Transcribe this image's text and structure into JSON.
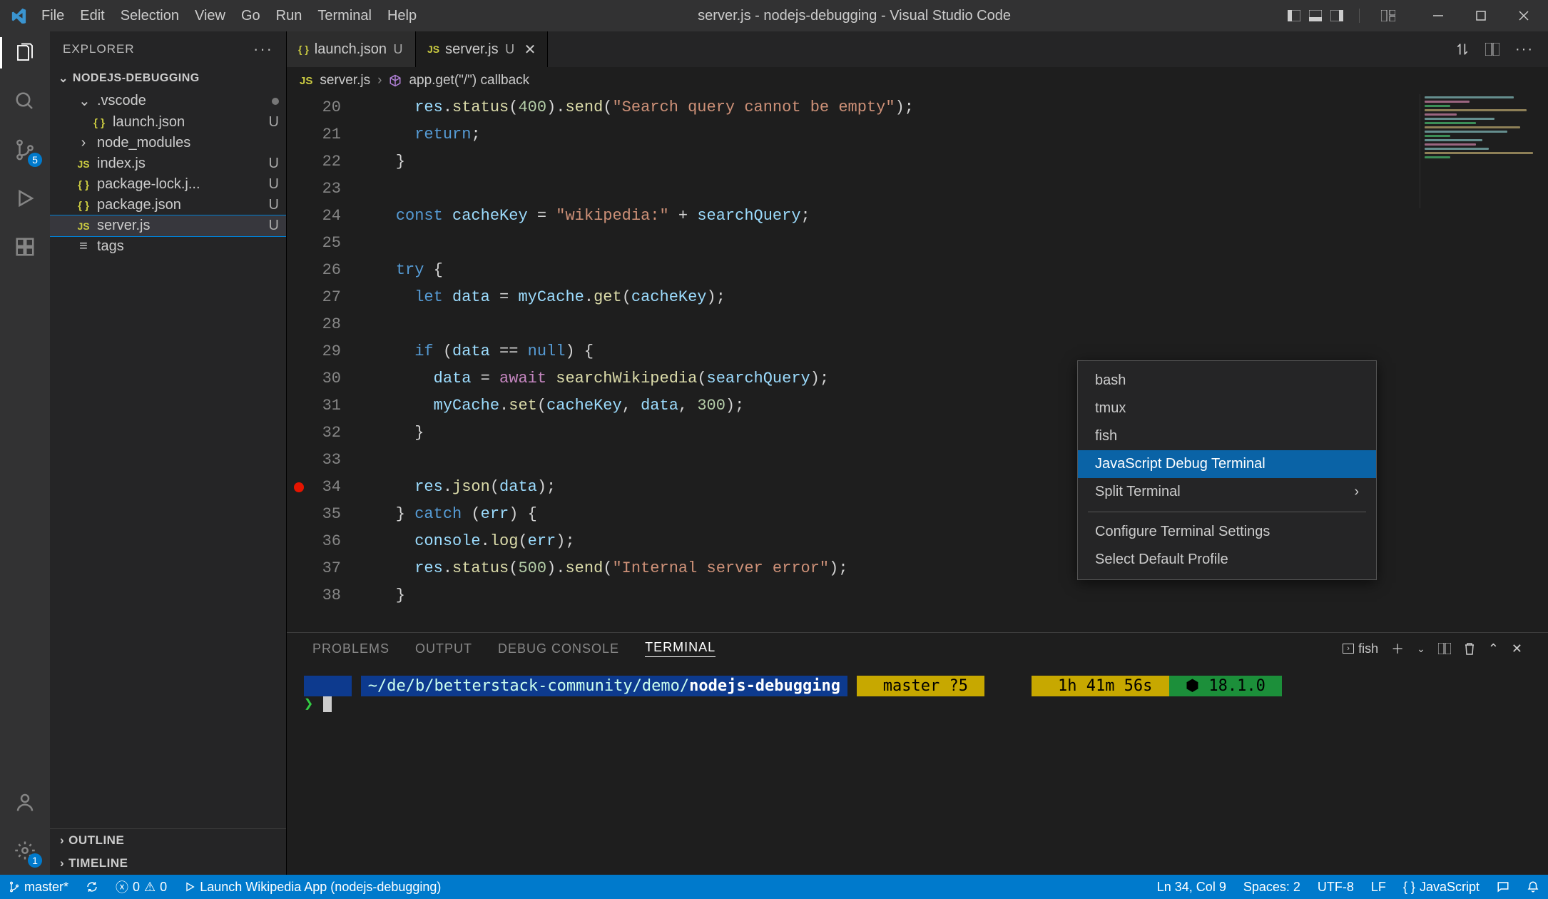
{
  "window": {
    "title": "server.js - nodejs-debugging - Visual Studio Code"
  },
  "menubar": [
    "File",
    "Edit",
    "Selection",
    "View",
    "Go",
    "Run",
    "Terminal",
    "Help"
  ],
  "activitybar": {
    "scm_badge": "5",
    "settings_badge": "1"
  },
  "sidebar": {
    "header": "EXPLORER",
    "section": "NODEJS-DEBUGGING",
    "tree": [
      {
        "depth": 1,
        "icon": "chevron-down",
        "label": ".vscode",
        "badge": "●"
      },
      {
        "depth": 2,
        "icon": "json",
        "label": "launch.json",
        "badge": "U"
      },
      {
        "depth": 1,
        "icon": "chevron-right",
        "label": "node_modules",
        "badge": ""
      },
      {
        "depth": 1,
        "icon": "js",
        "label": "index.js",
        "badge": "U"
      },
      {
        "depth": 1,
        "icon": "json",
        "label": "package-lock.j...",
        "badge": "U"
      },
      {
        "depth": 1,
        "icon": "json",
        "label": "package.json",
        "badge": "U"
      },
      {
        "depth": 1,
        "icon": "js",
        "label": "server.js",
        "badge": "U",
        "selected": true
      },
      {
        "depth": 1,
        "icon": "tags",
        "label": "tags",
        "badge": ""
      }
    ],
    "outline": "OUTLINE",
    "timeline": "TIMELINE"
  },
  "editor": {
    "tabs": [
      {
        "icon": "json",
        "label": "launch.json",
        "badge": "U",
        "active": false
      },
      {
        "icon": "js",
        "label": "server.js",
        "badge": "U",
        "active": true,
        "close": true
      }
    ],
    "breadcrumbs": {
      "icon1": "js",
      "part1": "server.js",
      "icon2": "cube",
      "part2": "app.get(\"/\") callback"
    },
    "gutter_start": 20,
    "breakpoint_line": 34,
    "lines": [
      "      res.status(400).send(\"Search query cannot be empty\");",
      "      return;",
      "    }",
      "",
      "    const cacheKey = \"wikipedia:\" + searchQuery;",
      "",
      "    try {",
      "      let data = myCache.get(cacheKey);",
      "",
      "      if (data == null) {",
      "        data = await searchWikipedia(searchQuery);",
      "        myCache.set(cacheKey, data, 300);",
      "      }",
      "",
      "      res.json(data);",
      "    } catch (err) {",
      "      console.log(err);",
      "      res.status(500).send(\"Internal server error\");",
      "    }"
    ]
  },
  "panel": {
    "tabs": [
      "PROBLEMS",
      "OUTPUT",
      "DEBUG CONSOLE",
      "TERMINAL"
    ],
    "active_tab": "TERMINAL",
    "shell_label": "fish"
  },
  "terminal": {
    "path": "~/de/b/betterstack-community/demo/",
    "path_bold": "nodejs-debugging",
    "branch": "master ?5",
    "time": "1h 41m 56s",
    "node_version": "18.1.0",
    "prompt": "❯"
  },
  "context_menu": {
    "items": [
      {
        "label": "bash"
      },
      {
        "label": "tmux"
      },
      {
        "label": "fish"
      },
      {
        "label": "JavaScript Debug Terminal",
        "selected": true
      },
      {
        "label": "Split Terminal",
        "chevron": true
      },
      {
        "sep": true
      },
      {
        "label": "Configure Terminal Settings"
      },
      {
        "label": "Select Default Profile"
      }
    ]
  },
  "statusbar": {
    "branch": "master*",
    "sync": "⟳",
    "errors": "0",
    "warnings": "0",
    "launch": "Launch Wikipedia App (nodejs-debugging)",
    "cursor": "Ln 34, Col 9",
    "spaces": "Spaces: 2",
    "encoding": "UTF-8",
    "eol": "LF",
    "lang": "JavaScript"
  }
}
